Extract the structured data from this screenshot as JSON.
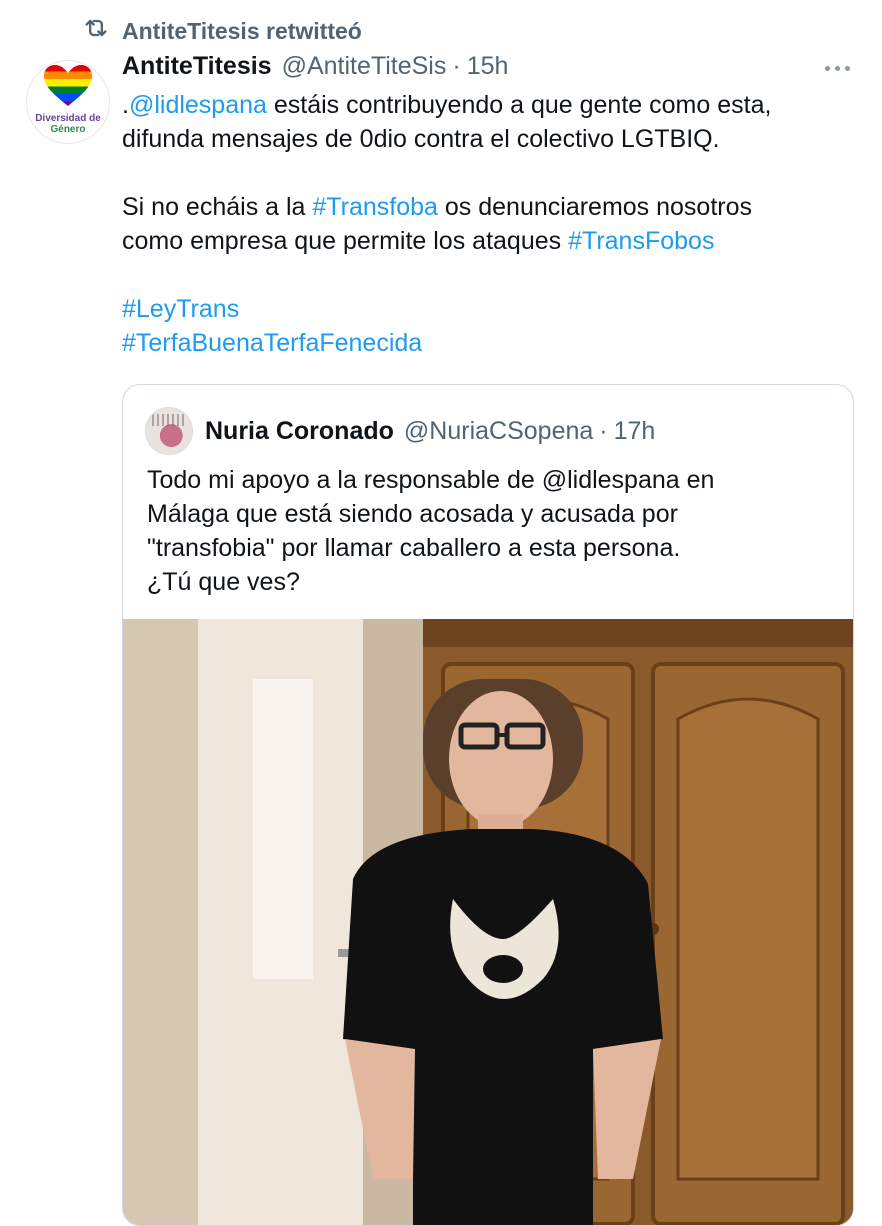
{
  "retweet_banner": {
    "label": "AntiteTitesis retwitteó",
    "icon": "retweet-icon"
  },
  "tweet": {
    "avatar": {
      "text_line1": "Diversidad de",
      "text_line2": "Género",
      "icon": "rainbow-heart-icon"
    },
    "author_name": "AntiteTitesis",
    "handle": "@AntiteTiteSis",
    "separator": "·",
    "time": "15h",
    "more_icon": "more-icon",
    "body": {
      "line1_prefix": ".",
      "line1_mention": "@lidlespana",
      "line1_rest": " estáis contribuyendo a que gente como esta,",
      "line2": "difunda mensajes de 0dio contra el colectivo LGTBIQ.",
      "line3_prefix": "Si no echáis a la ",
      "line3_hashtag": "#Transfoba",
      "line3_rest": " os denunciaremos nosotros",
      "line4_prefix": "como empresa que permite los ataques ",
      "line4_hashtag": "#TransFobos",
      "hashtag1": "#LeyTrans",
      "hashtag2": "#TerfaBuenaTerfaFenecida"
    }
  },
  "quoted_tweet": {
    "author_name": "Nuria Coronado",
    "handle": "@NuriaCSopena",
    "separator": "·",
    "time": "17h",
    "text_line1": "Todo mi apoyo a la responsable de @lidlespana en",
    "text_line2": "Málaga que está siendo acosada y acusada por",
    "text_line3": "\"transfobia\" por llamar caballero a esta persona.",
    "text_line4": "¿Tú que ves?",
    "photo": "photo"
  },
  "colors": {
    "link": "#1d9bf0",
    "secondary_text": "#536471",
    "primary_text": "#0f1419",
    "border": "#cfd9de"
  }
}
